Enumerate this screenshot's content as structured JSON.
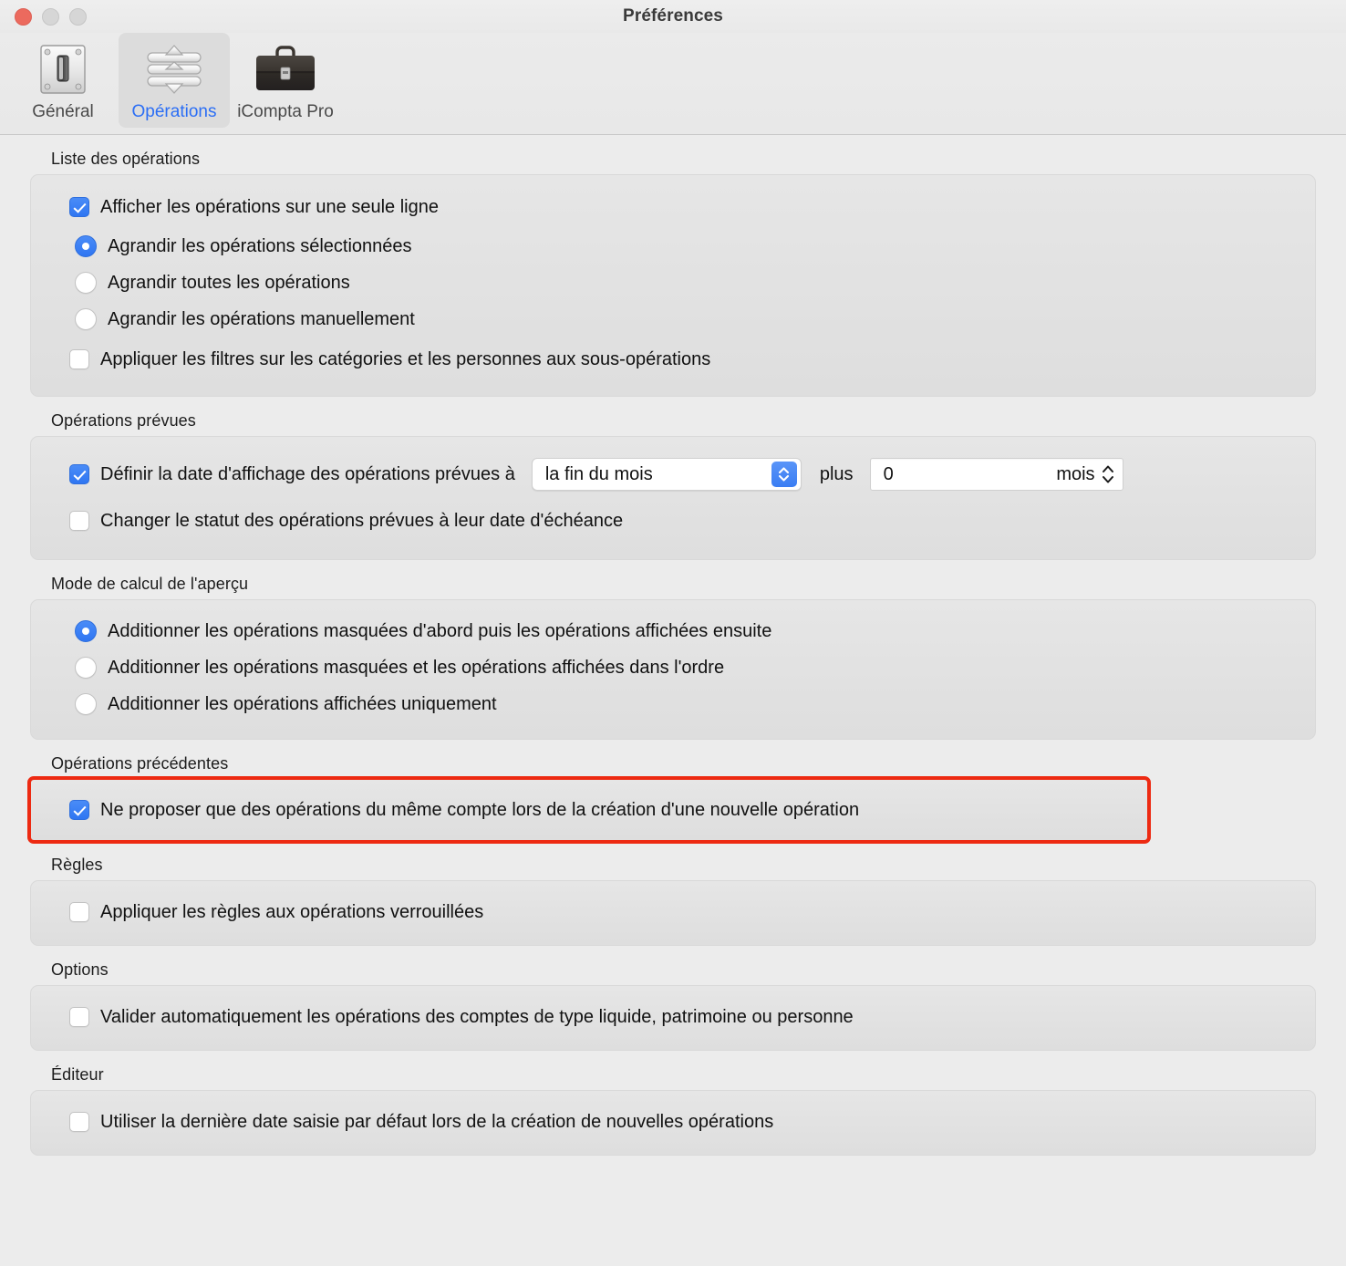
{
  "window": {
    "title": "Préférences",
    "traffic_lights": [
      "close",
      "minimize",
      "zoom"
    ],
    "accent_color": "#2f76f2",
    "highlight_color": "#ed2a12"
  },
  "toolbar": {
    "tabs": [
      {
        "label": "Général",
        "icon": "light-switch-icon",
        "selected": false
      },
      {
        "label": "Opérations",
        "icon": "sliders-icon",
        "selected": true
      },
      {
        "label": "iCompta Pro",
        "icon": "briefcase-icon",
        "selected": false
      }
    ]
  },
  "sections": [
    {
      "label": "Liste des opérations",
      "rows": [
        {
          "type": "checkbox",
          "checked": true,
          "label": "Afficher les opérations sur une seule ligne"
        },
        {
          "type": "radio",
          "checked": true,
          "label": "Agrandir les opérations sélectionnées"
        },
        {
          "type": "radio",
          "checked": false,
          "label": "Agrandir toutes les opérations"
        },
        {
          "type": "radio",
          "checked": false,
          "label": "Agrandir les opérations manuellement"
        },
        {
          "type": "checkbox",
          "checked": false,
          "label": "Appliquer les filtres sur les catégories et les personnes aux sous-opérations"
        }
      ]
    },
    {
      "label": "Opérations prévues",
      "rows": [
        {
          "type": "checkbox-popup-stepper",
          "checked": true,
          "label": "Définir la date d'affichage des opérations prévues à",
          "popup_value": "la fin du mois",
          "plus_label": "plus",
          "stepper_value": "0",
          "stepper_unit": "mois"
        },
        {
          "type": "checkbox",
          "checked": false,
          "label": "Changer le statut des opérations prévues à leur date d'échéance"
        }
      ]
    },
    {
      "label": "Mode de calcul de l'aperçu",
      "rows": [
        {
          "type": "radio",
          "checked": true,
          "label": "Additionner les opérations masquées d'abord puis les opérations affichées ensuite"
        },
        {
          "type": "radio",
          "checked": false,
          "label": "Additionner les opérations masquées et les opérations affichées dans l'ordre"
        },
        {
          "type": "radio",
          "checked": false,
          "label": "Additionner les opérations affichées uniquement"
        }
      ]
    },
    {
      "label": "Opérations précédentes",
      "highlighted": true,
      "rows": [
        {
          "type": "checkbox",
          "checked": true,
          "label": "Ne proposer que des opérations du même compte lors de la création d'une nouvelle opération"
        }
      ]
    },
    {
      "label": "Règles",
      "rows": [
        {
          "type": "checkbox",
          "checked": false,
          "label": "Appliquer les règles aux opérations verrouillées"
        }
      ]
    },
    {
      "label": "Options",
      "rows": [
        {
          "type": "checkbox",
          "checked": false,
          "label": "Valider automatiquement les opérations des comptes de type liquide, patrimoine ou personne"
        }
      ]
    },
    {
      "label": "Éditeur",
      "rows": [
        {
          "type": "checkbox",
          "checked": false,
          "label": "Utiliser la dernière date saisie par défaut lors de la création de nouvelles opérations"
        }
      ]
    }
  ]
}
